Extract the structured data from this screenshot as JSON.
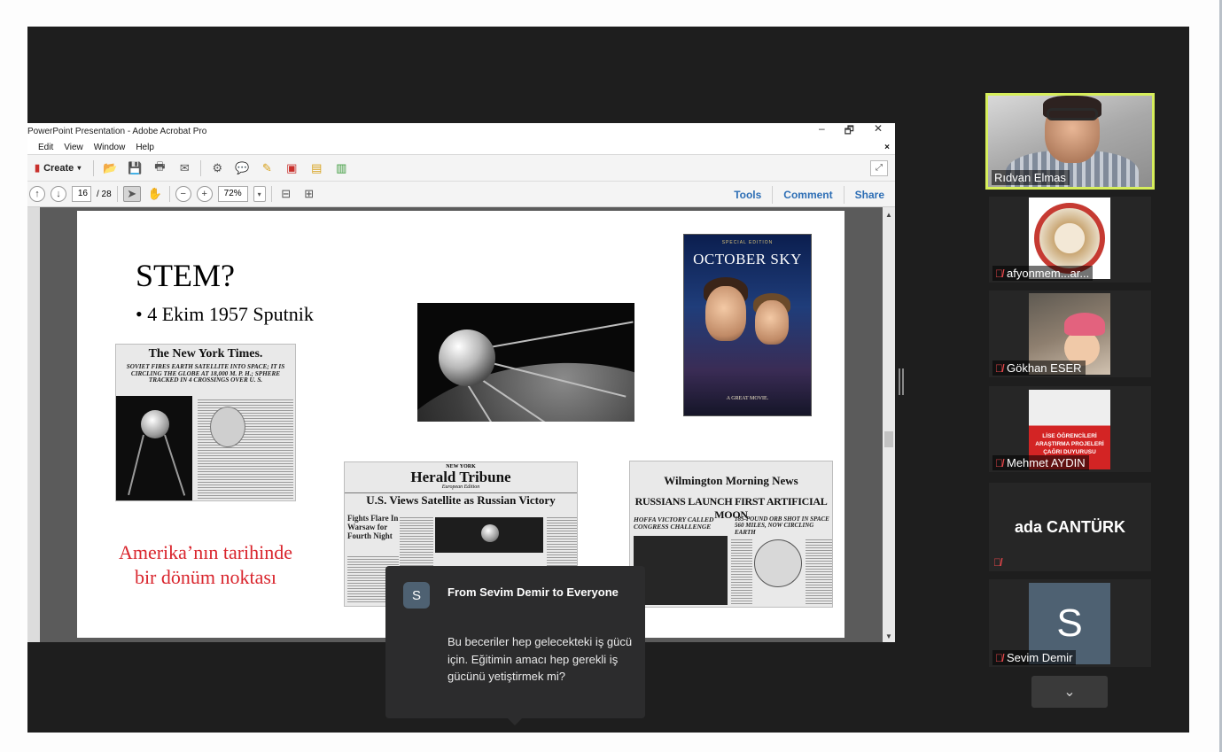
{
  "acrobat": {
    "window_title": "PowerPoint Presentation - Adobe Acrobat Pro",
    "window_controls": {
      "minimize": "–",
      "restore": "🗗",
      "close": "✕"
    },
    "menu": [
      "Edit",
      "View",
      "Window",
      "Help"
    ],
    "menu_close": "×",
    "toolbar": {
      "create_label": "Create"
    },
    "nav": {
      "current_page": "16",
      "total_pages": "/ 28",
      "zoom": "72%"
    },
    "tabs": [
      "Tools",
      "Comment",
      "Share"
    ]
  },
  "slide": {
    "title": "STEM?",
    "bullet": "• 4 Ekim 1957 Sputnik",
    "red_line1": "Amerika’nın tarihinde",
    "red_line2": "bir dönüm noktası",
    "nyt_masthead": "The New York Times.",
    "nyt_headline": "SOVIET FIRES EARTH SATELLITE INTO SPACE; IT IS CIRCLING THE GLOBE AT 18,000 M. P. H.; SPHERE TRACKED IN 4 CROSSINGS OVER U. S.",
    "poster_top": "SPECIAL EDITION",
    "poster_title": "OCTOBER SKY",
    "poster_tagline": "A GREAT MOVIE.",
    "herald_masthead_small": "NEW YORK",
    "herald_masthead": "Herald Tribune",
    "herald_edition": "European Edition",
    "herald_headline": "U.S. Views Satellite as Russian Victory",
    "herald_sub": "Fights Flare In Warsaw for Fourth Night",
    "wilm_masthead": "Wilmington Morning News",
    "wilm_headline": "RUSSIANS LAUNCH FIRST ARTIFICIAL MOON",
    "wilm_sub1": "HOFFA VICTORY CALLED CONGRESS CHALLENGE",
    "wilm_sub2": "185-POUND ORB SHOT IN SPACE 560 MILES, NOW CIRCLING EARTH"
  },
  "chat": {
    "avatar_letter": "S",
    "from": "From Sevim Demir to Everyone",
    "message": "Bu beceriler hep gelecekteki iş gücü için. Eğitimin amacı hep gerekli iş gücünü yetiştirmek mi?"
  },
  "participants": [
    {
      "name": "Rıdvan Elmas",
      "muted": false,
      "active_speaker": true
    },
    {
      "name": "afyonmem...ar...",
      "muted": true
    },
    {
      "name": "Gökhan ESER",
      "muted": true
    },
    {
      "name": "Mehmet AYDIN",
      "muted": true
    },
    {
      "name": "ada CANTÜRK",
      "muted": true
    },
    {
      "name": "Sevim Demir",
      "muted": true,
      "avatar_letter": "S"
    }
  ],
  "tile4_poster_text": "LİSE ÖĞRENCİLERİ ARAŞTIRMA PROJELERİ ÇAĞRI DUYURUSU",
  "icons": {
    "mute": "mic-muted-icon",
    "more": "chevron-down-icon"
  }
}
